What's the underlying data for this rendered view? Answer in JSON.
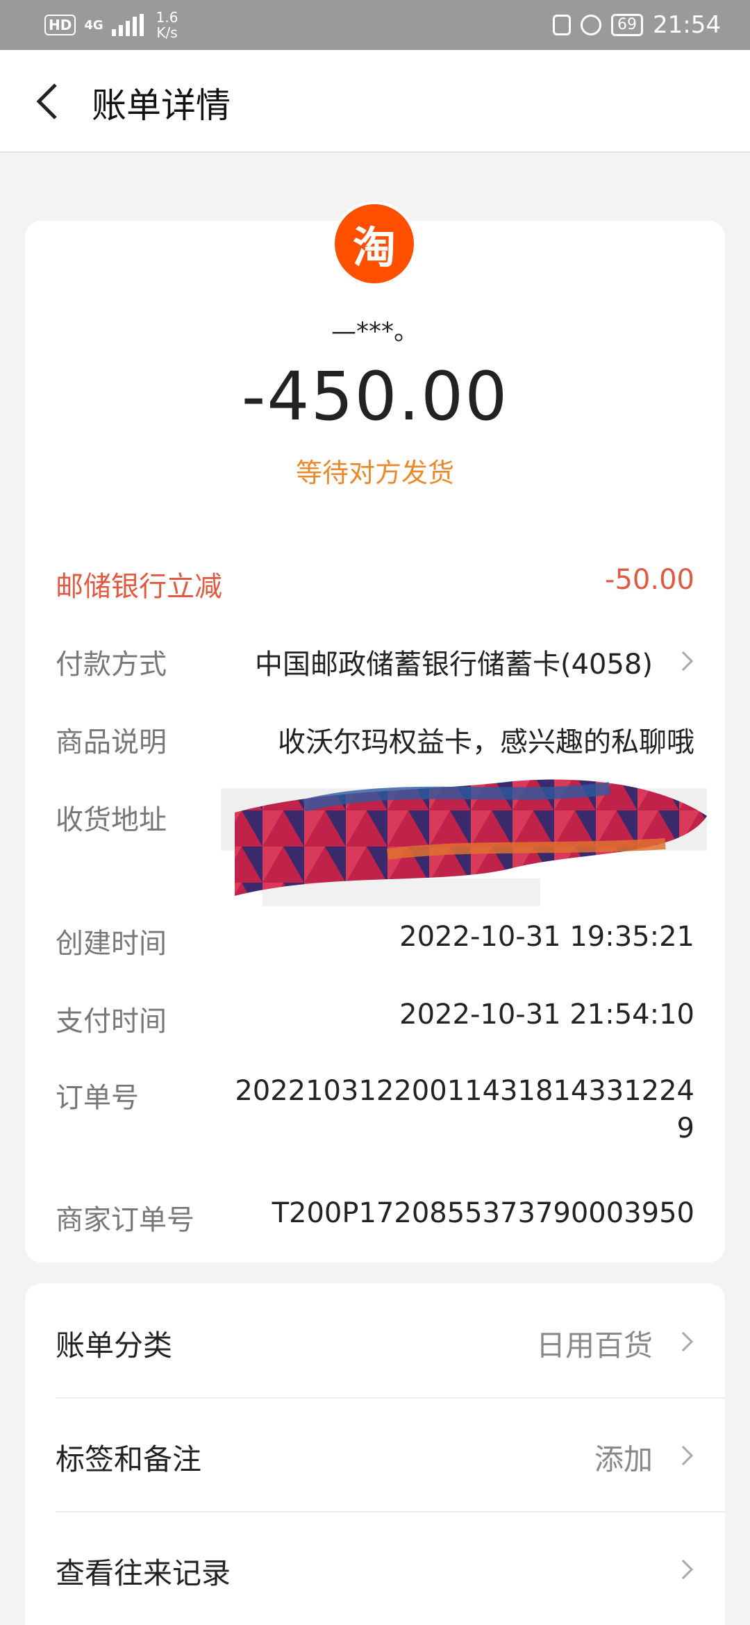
{
  "status_bar": {
    "hd": "HD",
    "network": "4G",
    "speed_value": "1.6",
    "speed_unit": "K/s",
    "battery": "69",
    "time": "21:54"
  },
  "nav": {
    "title": "账单详情"
  },
  "header": {
    "logo_text": "淘",
    "merchant": "—***。",
    "amount": "-450.00",
    "status": "等待对方发货"
  },
  "details": {
    "discount": {
      "label": "邮储银行立减",
      "value": "-50.00"
    },
    "payment_method": {
      "label": "付款方式",
      "value": "中国邮政储蓄银行储蓄卡(4058)"
    },
    "description": {
      "label": "商品说明",
      "value": "收沃尔玛权益卡，感兴趣的私聊哦"
    },
    "address": {
      "label": "收货地址"
    },
    "created_time": {
      "label": "创建时间",
      "value": "2022-10-31 19:35:21"
    },
    "pay_time": {
      "label": "支付时间",
      "value": "2022-10-31 21:54:10"
    },
    "order_no": {
      "label": "订单号",
      "value_line1": "20221031220011431814331224",
      "value_line2": "9"
    },
    "merchant_order_no": {
      "label": "商家订单号",
      "value": "T200P1720855373790003950"
    }
  },
  "actions": {
    "category": {
      "label": "账单分类",
      "value": "日用百货"
    },
    "tags": {
      "label": "标签和备注",
      "value": "添加"
    },
    "history": {
      "label": "查看往来记录"
    }
  },
  "colors": {
    "accent_orange": "#e8892b",
    "discount_red": "#e05a41",
    "taobao": "#ff5000"
  }
}
